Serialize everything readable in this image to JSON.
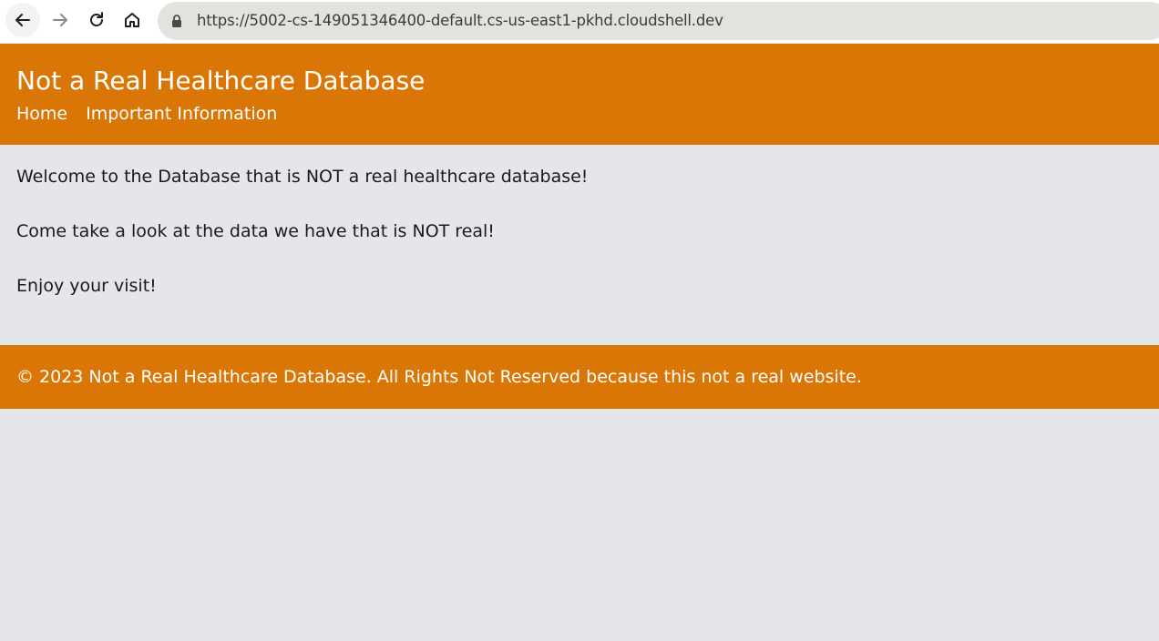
{
  "browser": {
    "url": "https://5002-cs-149051346400-default.cs-us-east1-pkhd.cloudshell.dev",
    "icons": [
      "back-arrow-icon",
      "forward-arrow-icon",
      "reload-icon",
      "home-icon",
      "lock-icon"
    ]
  },
  "header": {
    "title": "Not a Real Healthcare Database",
    "nav": [
      {
        "label": "Home"
      },
      {
        "label": "Important Information"
      }
    ]
  },
  "main": {
    "paragraphs": [
      "Welcome to the Database that is NOT a real healthcare database!",
      "Come take a look at the data we have that is NOT real!",
      "Enjoy your visit!"
    ]
  },
  "footer": {
    "text": "© 2023 Not a Real Healthcare Database. All Rights Not Reserved because this not a real website."
  },
  "colors": {
    "brand": "#da7606",
    "background": "#e5e6ea",
    "omnibox": "#e3e2df"
  }
}
